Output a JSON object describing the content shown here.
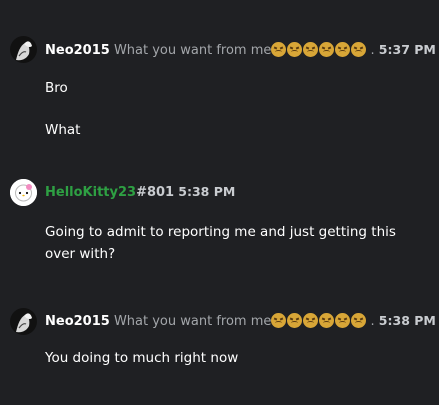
{
  "messages": [
    {
      "username": "Neo2015",
      "status": "What you want from me",
      "emoji": [
        "persevering-face",
        "persevering-face",
        "persevering-face",
        "persevering-face",
        "persevering-face",
        "persevering-face"
      ],
      "separator": ".",
      "time": "5:37 PM",
      "lines": [
        "Bro",
        "What"
      ]
    },
    {
      "username": "HelloKitty23",
      "tag": "#801",
      "time": "5:38 PM",
      "lines": [
        "Going to admit to reporting me and just getting this over with?"
      ]
    },
    {
      "username": "Neo2015",
      "status": "What you want from me",
      "emoji": [
        "persevering-face",
        "persevering-face",
        "persevering-face",
        "persevering-face",
        "persevering-face",
        "persevering-face"
      ],
      "separator": ".",
      "time": "5:38 PM",
      "lines": [
        "You doing to much right now"
      ]
    }
  ],
  "colors": {
    "background": "#1f2023",
    "username_default": "#ffffff",
    "username_hellokitty": "#2ea043",
    "muted": "#a3a6aa"
  }
}
